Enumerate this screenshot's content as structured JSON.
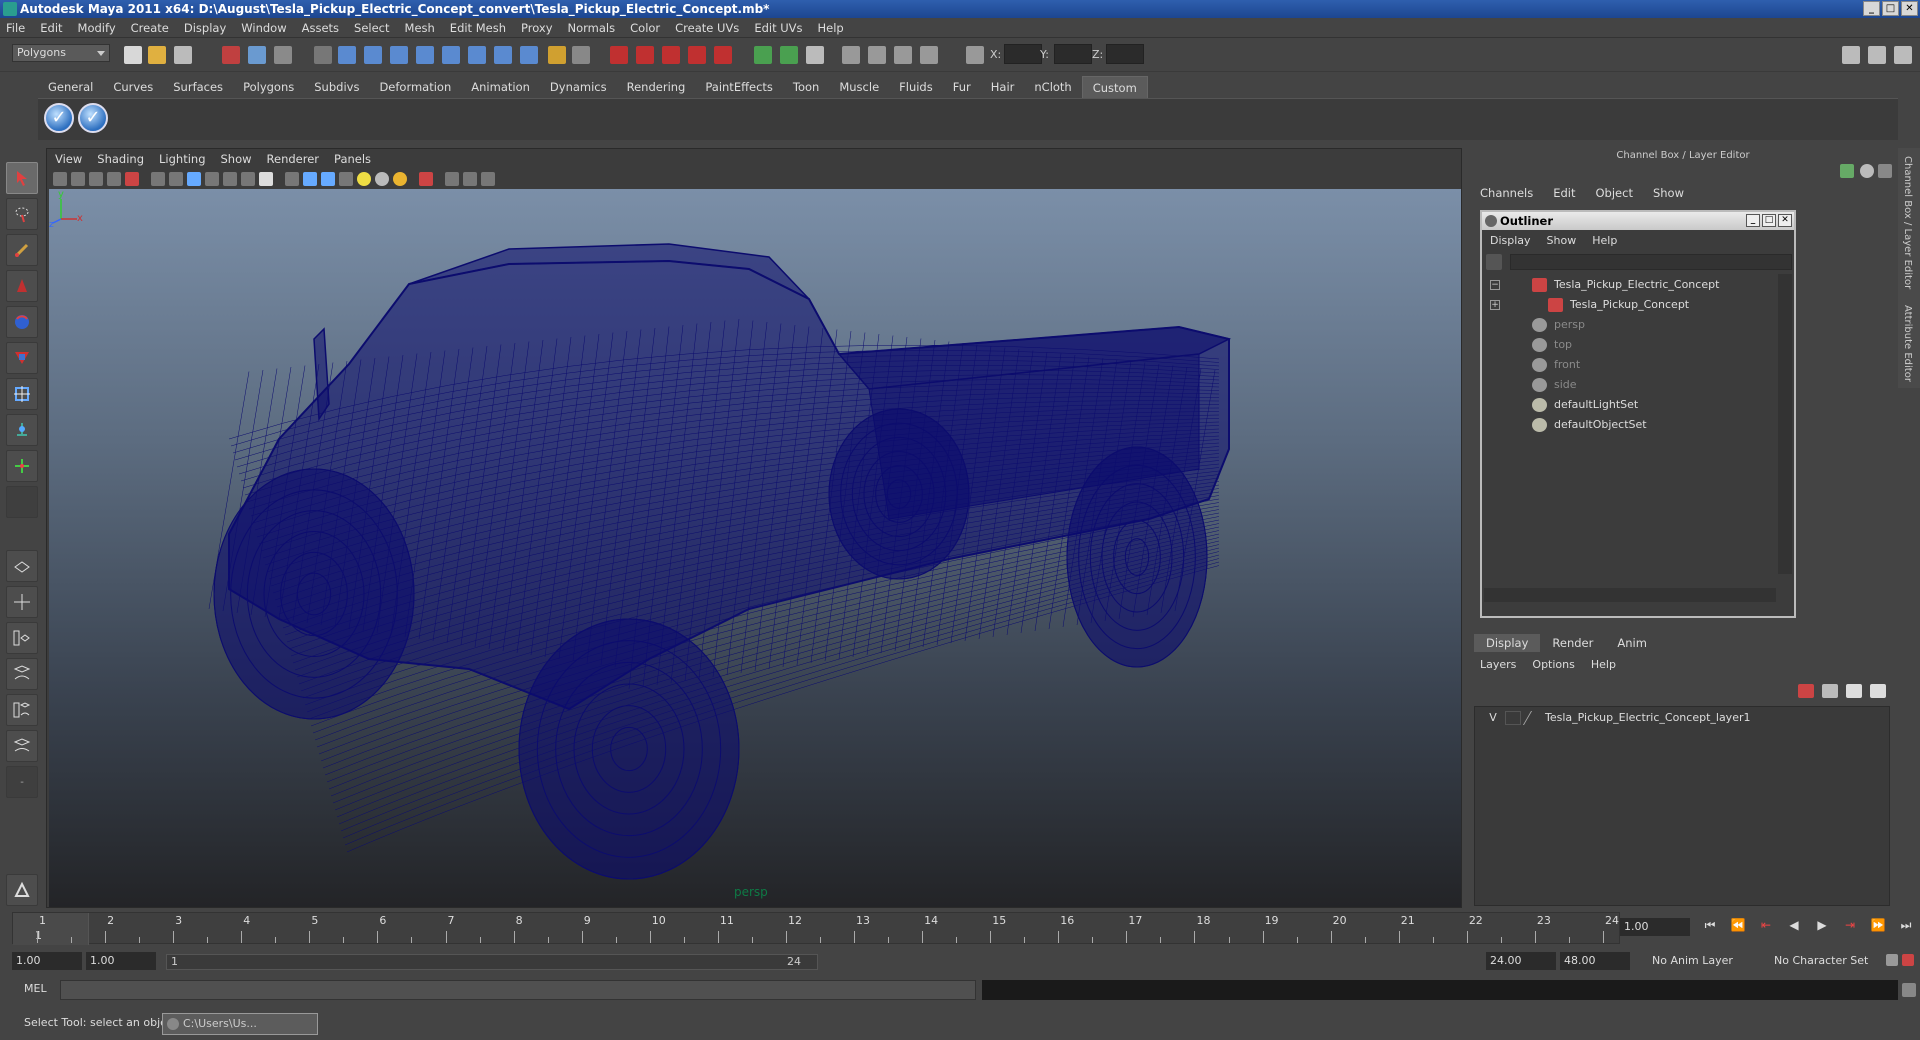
{
  "window": {
    "title": "Autodesk Maya 2011 x64: D:\\August\\Tesla_Pickup_Electric_Concept_convert\\Tesla_Pickup_Electric_Concept.mb*"
  },
  "menubar": [
    "File",
    "Edit",
    "Modify",
    "Create",
    "Display",
    "Window",
    "Assets",
    "Select",
    "Mesh",
    "Edit Mesh",
    "Proxy",
    "Normals",
    "Color",
    "Create UVs",
    "Edit UVs",
    "Help"
  ],
  "statusline": {
    "mode": "Polygons",
    "x_label": "X:",
    "y_label": "Y:",
    "z_label": "Z:"
  },
  "shelf_tabs": [
    "General",
    "Curves",
    "Surfaces",
    "Polygons",
    "Subdivs",
    "Deformation",
    "Animation",
    "Dynamics",
    "Rendering",
    "PaintEffects",
    "Toon",
    "Muscle",
    "Fluids",
    "Fur",
    "Hair",
    "nCloth",
    "Custom"
  ],
  "shelf_active": "Custom",
  "viewport": {
    "menu": [
      "View",
      "Shading",
      "Lighting",
      "Show",
      "Renderer",
      "Panels"
    ],
    "camera_label": "persp",
    "axis_y": "y",
    "axis_x": "x",
    "axis_z": "z"
  },
  "channel_box": {
    "title": "Channel Box / Layer Editor",
    "menu": [
      "Channels",
      "Edit",
      "Object",
      "Show"
    ]
  },
  "outliner": {
    "title": "Outliner",
    "menu": [
      "Display",
      "Show",
      "Help"
    ],
    "items": [
      {
        "label": "Tesla_Pickup_Electric_Concept",
        "expander": "−",
        "dim": false,
        "indent": 0,
        "icon": "transform-icon"
      },
      {
        "label": "Tesla_Pickup_Concept",
        "expander": "+",
        "dim": false,
        "indent": 16,
        "icon": "transform-icon"
      },
      {
        "label": "persp",
        "expander": "",
        "dim": true,
        "indent": 0,
        "icon": "camera-icon"
      },
      {
        "label": "top",
        "expander": "",
        "dim": true,
        "indent": 0,
        "icon": "camera-icon"
      },
      {
        "label": "front",
        "expander": "",
        "dim": true,
        "indent": 0,
        "icon": "camera-icon"
      },
      {
        "label": "side",
        "expander": "",
        "dim": true,
        "indent": 0,
        "icon": "camera-icon"
      },
      {
        "label": "defaultLightSet",
        "expander": "",
        "dim": false,
        "indent": 0,
        "icon": "set-icon"
      },
      {
        "label": "defaultObjectSet",
        "expander": "",
        "dim": false,
        "indent": 0,
        "icon": "set-icon"
      }
    ]
  },
  "layer_editor": {
    "tabs": [
      "Display",
      "Render",
      "Anim"
    ],
    "active_tab": "Display",
    "menu": [
      "Layers",
      "Options",
      "Help"
    ],
    "layers": [
      {
        "visible": "V",
        "name": "Tesla_Pickup_Electric_Concept_layer1"
      }
    ]
  },
  "right_tabs": [
    "Channel Box / Layer Editor",
    "Attribute Editor"
  ],
  "timeline": {
    "ticks": [
      "1",
      "2",
      "3",
      "4",
      "5",
      "6",
      "7",
      "8",
      "9",
      "10",
      "11",
      "12",
      "13",
      "14",
      "15",
      "16",
      "17",
      "18",
      "19",
      "20",
      "21",
      "22",
      "23",
      "24"
    ],
    "current_frame_label": "1",
    "current_time": "1.00"
  },
  "range": {
    "start_time": "1.00",
    "playback_start": "1.00",
    "slider_start": "1",
    "slider_end": "24",
    "playback_end": "24.00",
    "end_time": "48.00",
    "anim_layer": "No Anim Layer",
    "character_set": "No Character Set"
  },
  "command_line": {
    "label": "MEL"
  },
  "help_line": {
    "text": "Select Tool: select an object",
    "minimized_window": "C:\\Users\\Us..."
  },
  "colors": {
    "wireframe": "#0c0c6e",
    "title_bar": "#1d4690",
    "viewport_top": "#7b8fa8",
    "viewport_bottom": "#232427"
  }
}
